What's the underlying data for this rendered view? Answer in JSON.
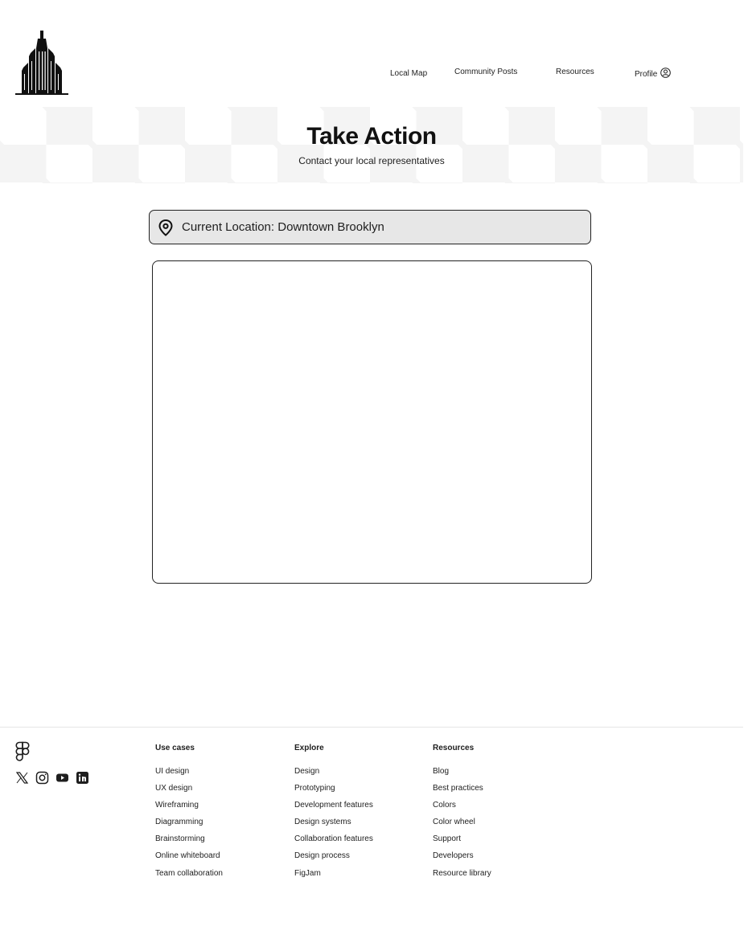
{
  "header": {
    "logo_icon": "skyscraper-logo-icon",
    "nav": {
      "local_map": "Local Map",
      "community_posts": "Community Posts",
      "resources": "Resources",
      "profile": "Profile",
      "profile_icon": "user-circle-icon"
    }
  },
  "hero": {
    "title": "Take Action",
    "subtitle": "Contact your local representatives"
  },
  "location": {
    "icon": "location-pin-icon",
    "text": "Current Location: Downtown Brooklyn"
  },
  "footer": {
    "logo_icon": "figma-logo-icon",
    "social_icons": [
      "x-icon",
      "instagram-icon",
      "youtube-icon",
      "linkedin-icon"
    ],
    "columns": [
      {
        "heading": "Use cases",
        "items": [
          "UI design",
          "UX design",
          "Wireframing",
          "Diagramming",
          "Brainstorming",
          "Online whiteboard",
          "Team collaboration"
        ]
      },
      {
        "heading": "Explore",
        "items": [
          "Design",
          "Prototyping",
          "Development features",
          "Design systems",
          "Collaboration features",
          "Design process",
          "FigJam"
        ]
      },
      {
        "heading": "Resources",
        "items": [
          "Blog",
          "Best practices",
          "Colors",
          "Color wheel",
          "Support",
          "Developers",
          "Resource library"
        ]
      }
    ]
  }
}
